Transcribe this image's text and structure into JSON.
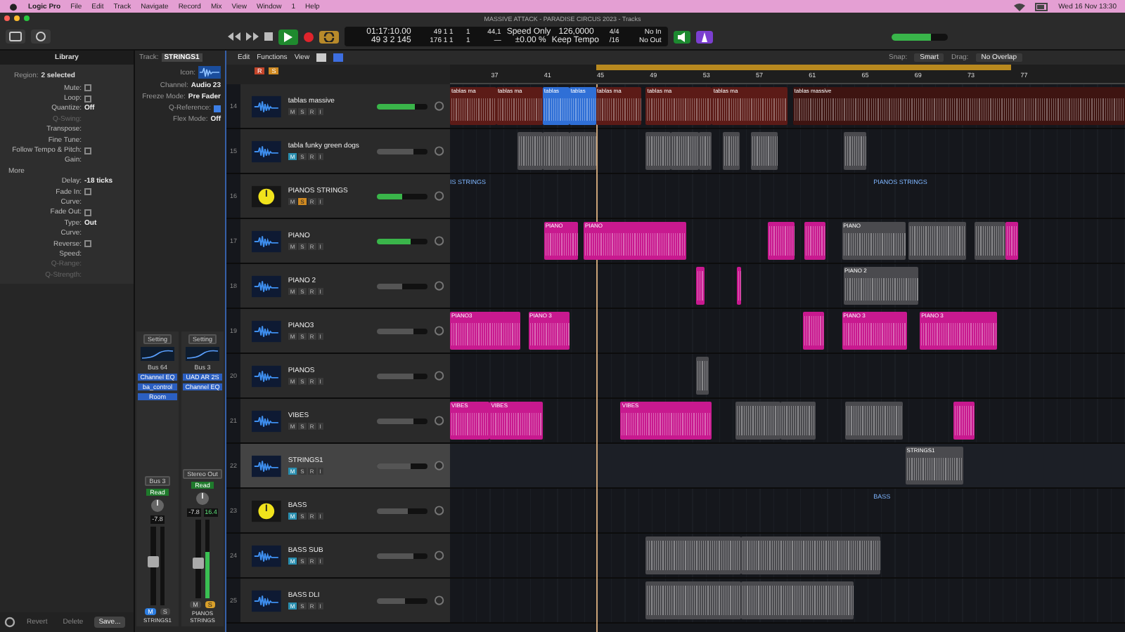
{
  "menu_bar": {
    "items": [
      "Logic Pro",
      "File",
      "Edit",
      "Track",
      "Navigate",
      "Record",
      "Mix",
      "View",
      "Window",
      "1",
      "Help"
    ],
    "clock": "Wed 16 Nov 13:30"
  },
  "window": {
    "title": "MASSIVE ATTACK - PARADISE CIRCUS 2023 - Tracks"
  },
  "lcd": {
    "rows": [
      [
        "01:17:10.00",
        "49  1  1",
        "1",
        "44,1",
        "Speed Only",
        "126,0000",
        "4/4",
        "No In"
      ],
      [
        "49  3  2  145",
        "176  1  1",
        "1",
        "—",
        "±0.00 %",
        "Keep Tempo",
        "/16",
        "No Out"
      ]
    ]
  },
  "master_volume": {
    "level": 0.72
  },
  "library": {
    "title": "Library",
    "region_label": "Region:",
    "region_value": "2 selected",
    "params": [
      {
        "kind": "check",
        "label": "Mute:",
        "checked": false,
        "disabled": false
      },
      {
        "kind": "check",
        "label": "Loop:",
        "checked": false,
        "disabled": false
      },
      {
        "kind": "value",
        "label": "Quantize:",
        "value": "Off",
        "disabled": false
      },
      {
        "kind": "value",
        "label": "Q-Swing:",
        "disabled": true
      },
      {
        "kind": "value",
        "label": "Transpose:",
        "disabled": false
      },
      {
        "kind": "value",
        "label": "Fine Tune:",
        "disabled": false
      },
      {
        "kind": "check",
        "label": "Follow Tempo & Pitch:",
        "checked": false,
        "disabled": false
      },
      {
        "kind": "value",
        "label": "Gain:",
        "disabled": false
      },
      {
        "kind": "header",
        "label": "More",
        "disabled": false
      },
      {
        "kind": "value",
        "label": "Delay:",
        "value": "-18 ticks",
        "disabled": false
      },
      {
        "kind": "check",
        "label": "Fade In:",
        "checked": false,
        "disabled": false
      },
      {
        "kind": "value",
        "label": "Curve:",
        "disabled": false
      },
      {
        "kind": "check",
        "label": "Fade Out:",
        "checked": false,
        "disabled": false
      },
      {
        "kind": "value",
        "label": "Type:",
        "value": "Out",
        "disabled": false
      },
      {
        "kind": "value",
        "label": "Curve:",
        "disabled": false
      },
      {
        "kind": "check",
        "label": "Reverse:",
        "checked": false,
        "disabled": false
      },
      {
        "kind": "value",
        "label": "Speed:",
        "disabled": false
      },
      {
        "kind": "value",
        "label": "Q-Range:",
        "disabled": true
      },
      {
        "kind": "value",
        "label": "Q-Strength:",
        "disabled": true
      }
    ],
    "buttons": [
      "Revert",
      "Delete",
      "Save..."
    ]
  },
  "track_inspector": {
    "title": "Track:",
    "name": "STRINGS1",
    "icon_label": "Icon:",
    "params": [
      {
        "kind": "value",
        "label": "Channel:",
        "value": "Audio 23"
      },
      {
        "kind": "value",
        "label": "Freeze Mode:",
        "value": "Pre Fader"
      },
      {
        "kind": "check",
        "label": "Q-Reference:",
        "checked": true
      },
      {
        "kind": "value",
        "label": "Flex Mode:",
        "value": "Off"
      }
    ]
  },
  "channel_strips": [
    {
      "setting": "Setting",
      "send": "Bus 64",
      "inserts": [
        "Channel EQ",
        "ba_control",
        "Room"
      ],
      "output": "Bus 3",
      "automation": "Read",
      "volume": "-7.8",
      "level": 0.55,
      "mute_label": "M",
      "solo_label": "S",
      "muted": true,
      "solo": false,
      "name": "STRINGS1"
    },
    {
      "setting": "Setting",
      "send": "Bus 3",
      "inserts": [
        "UAD AR 2S",
        "Channel EQ"
      ],
      "output": "Stereo Out",
      "automation": "Read",
      "volume": "-7.8",
      "peak": "16.4",
      "level": 0.45,
      "meter": {
        "level": 0.6
      },
      "mute_label": "M",
      "solo_label": "S",
      "muted": false,
      "solo": true,
      "name": "PIANOS STRINGS"
    }
  ],
  "toolbar": {
    "menus": [
      "Edit",
      "Functions",
      "View"
    ],
    "snap_label": "Snap:",
    "snap": "Smart",
    "drag_label": "Drag:",
    "drag": "No Overlap",
    "header_buttons": [
      "R",
      "S"
    ]
  },
  "ruler": {
    "labels": [
      "37",
      "41",
      "45",
      "49",
      "53",
      "57",
      "61",
      "65",
      "69",
      "73",
      "77"
    ]
  },
  "tracks": [
    {
      "number": "14",
      "name": "tablas massive",
      "kind": "audio",
      "level": 0.75,
      "fader_lit": true,
      "muted": false,
      "solo": false,
      "selected": false,
      "buttons": [
        "M",
        "S",
        "R",
        "I"
      ],
      "regions": [
        {
          "color": "#5c1b17",
          "name": "tablas ma"
        },
        {
          "color": "#5c1b17",
          "name": "tablas ma"
        },
        {
          "color": "#2f6fd6",
          "name": "tablas"
        },
        {
          "color": "#2f6fd6",
          "name": "tablas"
        },
        {
          "color": "#5c1b17",
          "name": "tablas ma"
        },
        {
          "color": "#5c1b17",
          "name": "tablas ma"
        },
        {
          "color": "#5c1b17",
          "name": "tablas ma"
        },
        {
          "color": "#3e1411",
          "name": "tablas massive"
        }
      ]
    },
    {
      "number": "15",
      "name": "tabla funky green dogs",
      "kind": "audio",
      "level": 0.7,
      "fader_lit": false,
      "muted": true,
      "solo": false,
      "selected": false,
      "buttons": [
        "M",
        "S",
        "R",
        "I"
      ],
      "regions": [
        {
          "color": "#4a4a4e"
        },
        {
          "color": "#4a4a4e"
        },
        {
          "color": "#4a4a4e"
        },
        {
          "color": "#4a4a4e"
        },
        {
          "color": "#4a4a4e"
        },
        {
          "color": "#4a4a4e"
        },
        {
          "color": "#4a4a4e"
        },
        {
          "color": "#4a4a4e"
        },
        {
          "color": "#4a4a4e"
        }
      ]
    },
    {
      "number": "16",
      "name": "PIANOS STRINGS",
      "kind": "stack",
      "level": 0.5,
      "fader_lit": true,
      "muted": false,
      "solo": true,
      "selected": false,
      "buttons": [
        "M",
        "S",
        "R",
        "I"
      ],
      "labels": [
        {
          "text": "IS STRINGS"
        },
        {
          "text": "PIANOS STRINGS"
        }
      ]
    },
    {
      "number": "17",
      "name": "PIANO",
      "kind": "audio",
      "level": 0.65,
      "fader_lit": true,
      "muted": false,
      "solo": false,
      "selected": false,
      "buttons": [
        "M",
        "S",
        "R",
        "I"
      ],
      "regions": [
        {
          "color": "#c8198f",
          "name": "PIANO"
        },
        {
          "color": "#c8198f",
          "name": "PIANO"
        },
        {
          "color": "#c8198f"
        },
        {
          "color": "#c8198f"
        },
        {
          "color": "#4a4a4e",
          "name": "PIANO"
        },
        {
          "color": "#4a4a4e"
        },
        {
          "color": "#4a4a4e"
        },
        {
          "color": "#c8198f"
        }
      ]
    },
    {
      "number": "18",
      "name": "PIANO 2",
      "kind": "audio",
      "level": 0.5,
      "fader_lit": false,
      "muted": false,
      "solo": false,
      "selected": false,
      "buttons": [
        "M",
        "S",
        "R",
        "I"
      ],
      "regions": [
        {
          "color": "#c8198f"
        },
        {
          "color": "#c8198f"
        },
        {
          "color": "#4a4a4e",
          "name": "PIANO 2"
        }
      ]
    },
    {
      "number": "19",
      "name": "PIANO3",
      "kind": "audio",
      "level": 0.7,
      "fader_lit": false,
      "muted": false,
      "solo": false,
      "selected": false,
      "buttons": [
        "M",
        "S",
        "R",
        "I"
      ],
      "regions": [
        {
          "color": "#c8198f",
          "name": "PIANO3"
        },
        {
          "color": "#c8198f",
          "name": "PIANO 3"
        },
        {
          "color": "#c8198f"
        },
        {
          "color": "#c8198f",
          "name": "PIANO 3"
        },
        {
          "color": "#c8198f",
          "name": "PIANO 3"
        }
      ]
    },
    {
      "number": "20",
      "name": "PIANOS",
      "kind": "audio",
      "level": 0.7,
      "fader_lit": false,
      "muted": false,
      "solo": false,
      "selected": false,
      "buttons": [
        "M",
        "S",
        "R",
        "I"
      ],
      "regions": [
        {
          "color": "#4a4a4e"
        }
      ]
    },
    {
      "number": "21",
      "name": "VIBES",
      "kind": "audio",
      "level": 0.7,
      "fader_lit": false,
      "muted": false,
      "solo": false,
      "selected": false,
      "buttons": [
        "M",
        "S",
        "R",
        "I"
      ],
      "regions": [
        {
          "color": "#c8198f",
          "name": "VIBES"
        },
        {
          "color": "#c8198f",
          "name": "VIBES"
        },
        {
          "color": "#c8198f",
          "name": "VIBES"
        },
        {
          "color": "#4a4a4e"
        },
        {
          "color": "#4a4a4e"
        },
        {
          "color": "#4a4a4e"
        },
        {
          "color": "#c8198f"
        }
      ]
    },
    {
      "number": "22",
      "name": "STRINGS1",
      "kind": "audio",
      "level": 0.65,
      "fader_lit": false,
      "muted": true,
      "solo": false,
      "selected": true,
      "buttons": [
        "M",
        "S",
        "R",
        "I"
      ],
      "regions": [
        {
          "color": "#4a4a4e",
          "name": "STRINGS1"
        }
      ]
    },
    {
      "number": "23",
      "name": "BASS",
      "kind": "stack",
      "level": 0.6,
      "fader_lit": false,
      "muted": true,
      "solo": false,
      "selected": false,
      "buttons": [
        "M",
        "S",
        "R",
        "I"
      ],
      "labels": [
        {
          "text": "BASS"
        }
      ]
    },
    {
      "number": "24",
      "name": "BASS SUB",
      "kind": "audio",
      "level": 0.7,
      "fader_lit": false,
      "muted": true,
      "solo": false,
      "selected": false,
      "buttons": [
        "M",
        "S",
        "R",
        "I"
      ],
      "regions": [
        {
          "color": "#4a4a4e"
        },
        {
          "color": "#4a4a4e"
        }
      ]
    },
    {
      "number": "25",
      "name": "BASS DLI",
      "kind": "audio",
      "level": 0.55,
      "fader_lit": false,
      "muted": true,
      "solo": false,
      "selected": false,
      "buttons": [
        "M",
        "S",
        "R",
        "I"
      ],
      "regions": [
        {
          "color": "#4a4a4e"
        },
        {
          "color": "#4a4a4e"
        }
      ]
    }
  ]
}
